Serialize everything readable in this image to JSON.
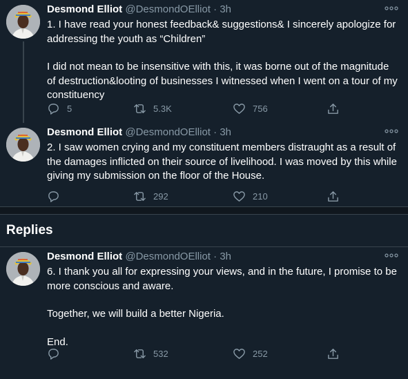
{
  "tweets": [
    {
      "name": "Desmond Elliot",
      "handle": "@DesmondOElliot",
      "time": "3h",
      "paragraphs": [
        "1. I have read your honest feedback& suggestions& I sincerely apologize for addressing the youth as “Children”",
        "I did not mean to be insensitive with this, it was borne out of the magnitude of destruction&looting of businesses I witnessed when I went on a tour of my constituency"
      ],
      "replies": "5",
      "retweets": "5.3K",
      "likes": "756"
    },
    {
      "name": "Desmond Elliot",
      "handle": "@DesmondOElliot",
      "time": "3h",
      "paragraphs": [
        "2. I saw women crying and my constituent members distraught as a result of the damages inflicted on their source of livelihood. I was moved by this while giving my submission on the floor of the House."
      ],
      "replies": "",
      "retweets": "292",
      "likes": "210"
    }
  ],
  "replies_section": {
    "title": "Replies"
  },
  "reply_tweets": [
    {
      "name": "Desmond Elliot",
      "handle": "@DesmondOElliot",
      "time": "3h",
      "paragraphs": [
        "6. I thank you all for expressing your views, and in the future, I promise to be more conscious and aware.",
        "Together, we will build a better Nigeria.",
        "End."
      ],
      "replies": "",
      "retweets": "532",
      "likes": "252"
    }
  ],
  "separator": "·",
  "colors": {
    "background": "#15202b",
    "secondary_text": "#8899a6",
    "border": "#38444d"
  },
  "icons": [
    "more-icon",
    "reply-icon",
    "retweet-icon",
    "like-icon",
    "share-icon"
  ]
}
